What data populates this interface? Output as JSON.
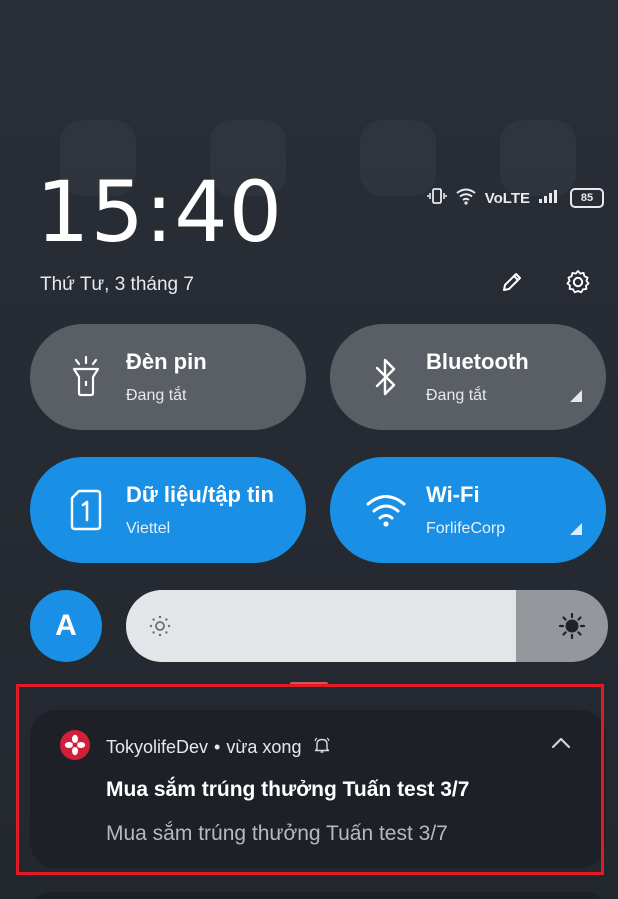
{
  "clock": {
    "time": "15:40",
    "date": "Thứ Tư, 3 tháng 7"
  },
  "status_bar": {
    "network": "VoLTE",
    "battery": "85"
  },
  "header_icons": [
    "edit-icon",
    "settings-icon"
  ],
  "tiles": [
    {
      "title": "Đèn pin",
      "subtitle": "Đang tắt",
      "state": "off",
      "icon": "flashlight-icon"
    },
    {
      "title": "Bluetooth",
      "subtitle": "Đang tắt",
      "state": "off",
      "icon": "bluetooth-icon"
    },
    {
      "title": "Dữ liệu/tập tin",
      "subtitle": "Viettel",
      "state": "on",
      "icon": "sim-card-icon"
    },
    {
      "title": "Wi-Fi",
      "subtitle": "ForlifeCorp",
      "state": "on",
      "icon": "wifi-icon"
    }
  ],
  "auto_brightness": {
    "label": "A"
  },
  "brightness": {
    "level": 0.81
  },
  "notification": {
    "app_name": "TokyolifeDev",
    "separator": "•",
    "time": "vừa xong",
    "title": "Mua sắm trúng thưởng Tuấn test 3/7",
    "body": "Mua sắm trúng thưởng Tuấn test 3/7"
  },
  "colors": {
    "accent": "#1a8fe6",
    "tile_off": "#5a5e65",
    "highlight": "#e01b24"
  }
}
